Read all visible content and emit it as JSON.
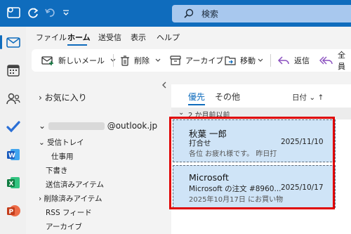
{
  "search": {
    "placeholder": "検索"
  },
  "menu": {
    "items": [
      "ファイル",
      "ホーム",
      "送受信",
      "表示",
      "ヘルプ"
    ]
  },
  "ribbon": {
    "new_mail": "新しいメール",
    "delete": "削除",
    "archive": "アーカイブ",
    "move": "移動",
    "reply": "返信",
    "reply_all": "全員"
  },
  "folders": {
    "favorites": "お気に入り",
    "account": "@outlook.jp",
    "inbox": "受信トレイ",
    "inbox_sub": "仕事用",
    "drafts": "下書き",
    "sent": "送信済みアイテム",
    "deleted": "削除済みアイテム",
    "rss": "RSS フィード",
    "archive": "アーカイブ"
  },
  "list": {
    "tab_focused": "優先",
    "tab_other": "その他",
    "sort": "日付",
    "group_header": "2 か月前以前",
    "messages": [
      {
        "sender": "秋葉 一郎",
        "subject": "打合せ",
        "date": "2025/11/10",
        "preview": "各位 お疲れ様です。 昨日打"
      },
      {
        "sender": "Microsoft",
        "subject": "Microsoft の注文 #8960...",
        "date": "2025/10/17",
        "preview": "2025年10月17日 にお買い物"
      }
    ]
  },
  "colors": {
    "accent": "#0f6cbd",
    "selected_bg": "#cfe4f7",
    "highlight": "#e00000"
  }
}
